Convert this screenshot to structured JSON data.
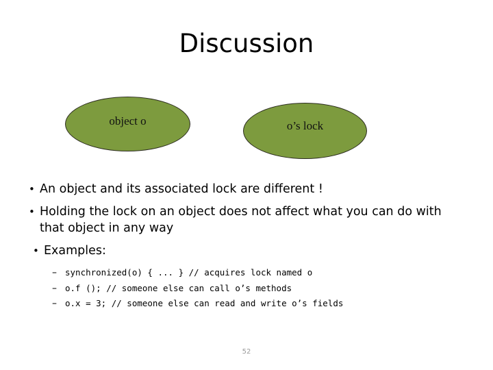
{
  "slide": {
    "title": "Discussion",
    "page_number": "52",
    "accent_color": "#7d9b3e",
    "outline_color": "#2b2b20",
    "page_number_color": "#9a9a9a"
  },
  "diagram": {
    "shapes": [
      {
        "label": "object o",
        "shape": "ellipse",
        "fill": "#7d9b3e"
      },
      {
        "label": "o’s lock",
        "shape": "ellipse",
        "fill": "#7d9b3e"
      }
    ]
  },
  "body": {
    "bullet_marker": "•",
    "sub_marker": "–",
    "bullets": [
      {
        "text": "An object and its associated lock are different !"
      },
      {
        "text": "Holding the lock on an object does not affect what you can do with that object in any way"
      },
      {
        "text": "Examples:"
      }
    ],
    "sub_bullets": [
      {
        "code": "synchronized(o) { ... } // acquires lock named o"
      },
      {
        "code": "o.f (); // someone else can call o’s methods"
      },
      {
        "code": "o.x = 3; // someone else can read and write o’s fields"
      }
    ]
  }
}
